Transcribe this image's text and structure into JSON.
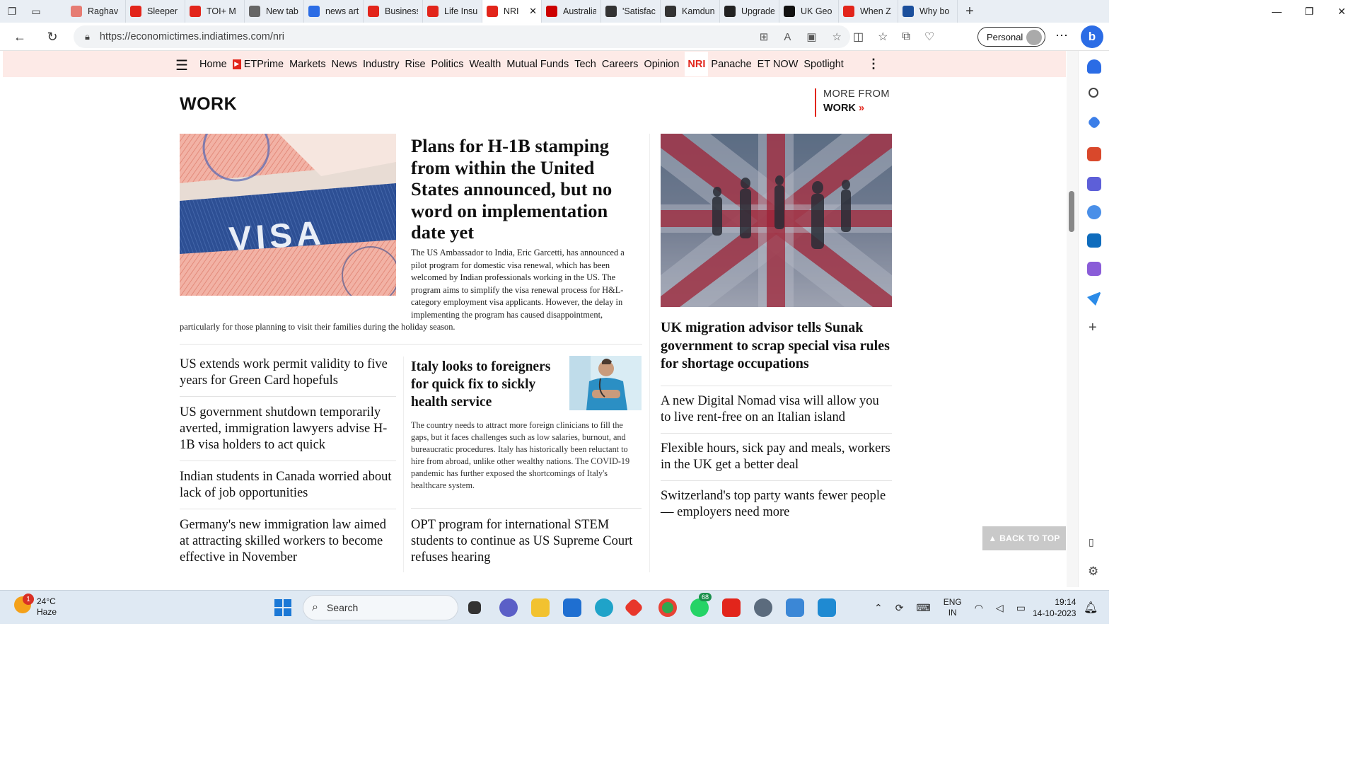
{
  "browser": {
    "tabs": [
      {
        "label": "Raghav",
        "color": "#e67c73"
      },
      {
        "label": "Sleeper",
        "color": "#e2251b"
      },
      {
        "label": "TOI+ M",
        "color": "#e2251b"
      },
      {
        "label": "New tab",
        "color": "#666666"
      },
      {
        "label": "news art",
        "color": "#2b6ce5"
      },
      {
        "label": "Business",
        "color": "#e2251b"
      },
      {
        "label": "Life Insu",
        "color": "#e2251b"
      },
      {
        "label": "NRI",
        "color": "#e2251b"
      },
      {
        "label": "Australia",
        "color": "#cc0000"
      },
      {
        "label": "'Satisfac",
        "color": "#333333"
      },
      {
        "label": "Kamdun",
        "color": "#333333"
      },
      {
        "label": "Upgrade",
        "color": "#222222"
      },
      {
        "label": "UK Geo",
        "color": "#111111"
      },
      {
        "label": "When Z",
        "color": "#e2251b"
      },
      {
        "label": "Why bo",
        "color": "#1b4f9c"
      }
    ],
    "active_tab": 7,
    "url": "https://economictimes.indiatimes.com/nri",
    "profile_label": "Personal"
  },
  "sitenav": {
    "items": [
      "Home",
      "ETPrime",
      "Markets",
      "News",
      "Industry",
      "Rise",
      "Politics",
      "Wealth",
      "Mutual Funds",
      "Tech",
      "Careers",
      "Opinion",
      "NRI",
      "Panache",
      "ET NOW",
      "Spotlight"
    ],
    "active": "NRI"
  },
  "section": {
    "title": "WORK",
    "more_from_label": "MORE FROM",
    "more_from_section": "WORK"
  },
  "lead": {
    "headline": "Plans for H-1B stamping from within the United States announced, but no word on implementation date yet",
    "summary": "The US Ambassador to India, Eric Garcetti, has announced a pilot program for domestic visa renewal, which has been welcomed by Indian professionals working in the US. The program aims to simplify the visa renewal process for H&L-category employment visa applicants. However, the delay in implementing the program has caused disappointment, particularly for those planning to visit their families during the holiday season.",
    "image_text": "VISA"
  },
  "left_list": [
    "US extends work permit validity to five years for Green Card hopefuls",
    "US government shutdown temporarily averted, immigration lawyers advise H-1B visa holders to act quick",
    "Indian students in Canada worried about lack of job opportunities",
    "Germany's new immigration law aimed at attracting skilled workers to become effective in November"
  ],
  "mid_story": {
    "headline": "Italy looks to foreigners for quick fix to sickly health service",
    "summary": "The country needs to attract more foreign clinicians to fill the gaps, but it faces challenges such as low salaries, burnout, and bureaucratic procedures. Italy has historically been reluctant to hire from abroad, unlike other wealthy nations. The COVID-19 pandemic has further exposed the shortcomings of Italy's healthcare system."
  },
  "mid_list": [
    "OPT program for international STEM students to continue as US Supreme Court refuses hearing"
  ],
  "right_story": {
    "headline": "UK migration advisor tells Sunak government to scrap special visa rules for shortage occupations"
  },
  "right_list": [
    "A new Digital Nomad visa will allow you to live rent-free on an Italian island",
    "Flexible hours, sick pay and meals, workers in the UK get a better deal",
    "Switzerland's top party wants fewer people — employers need more"
  ],
  "back_to_top": "▲ BACK TO TOP",
  "taskbar": {
    "weather_temp": "24°C",
    "weather_desc": "Haze",
    "weather_badge": "1",
    "search_placeholder": "Search",
    "whatsapp_badge": "68",
    "lang_line1": "ENG",
    "lang_line2": "IN",
    "time": "19:14",
    "date": "14-10-2023"
  },
  "colors": {
    "accent": "#e2251b",
    "nav_bg": "#fdeae7",
    "taskbar_bg": "#dfe9f3"
  }
}
